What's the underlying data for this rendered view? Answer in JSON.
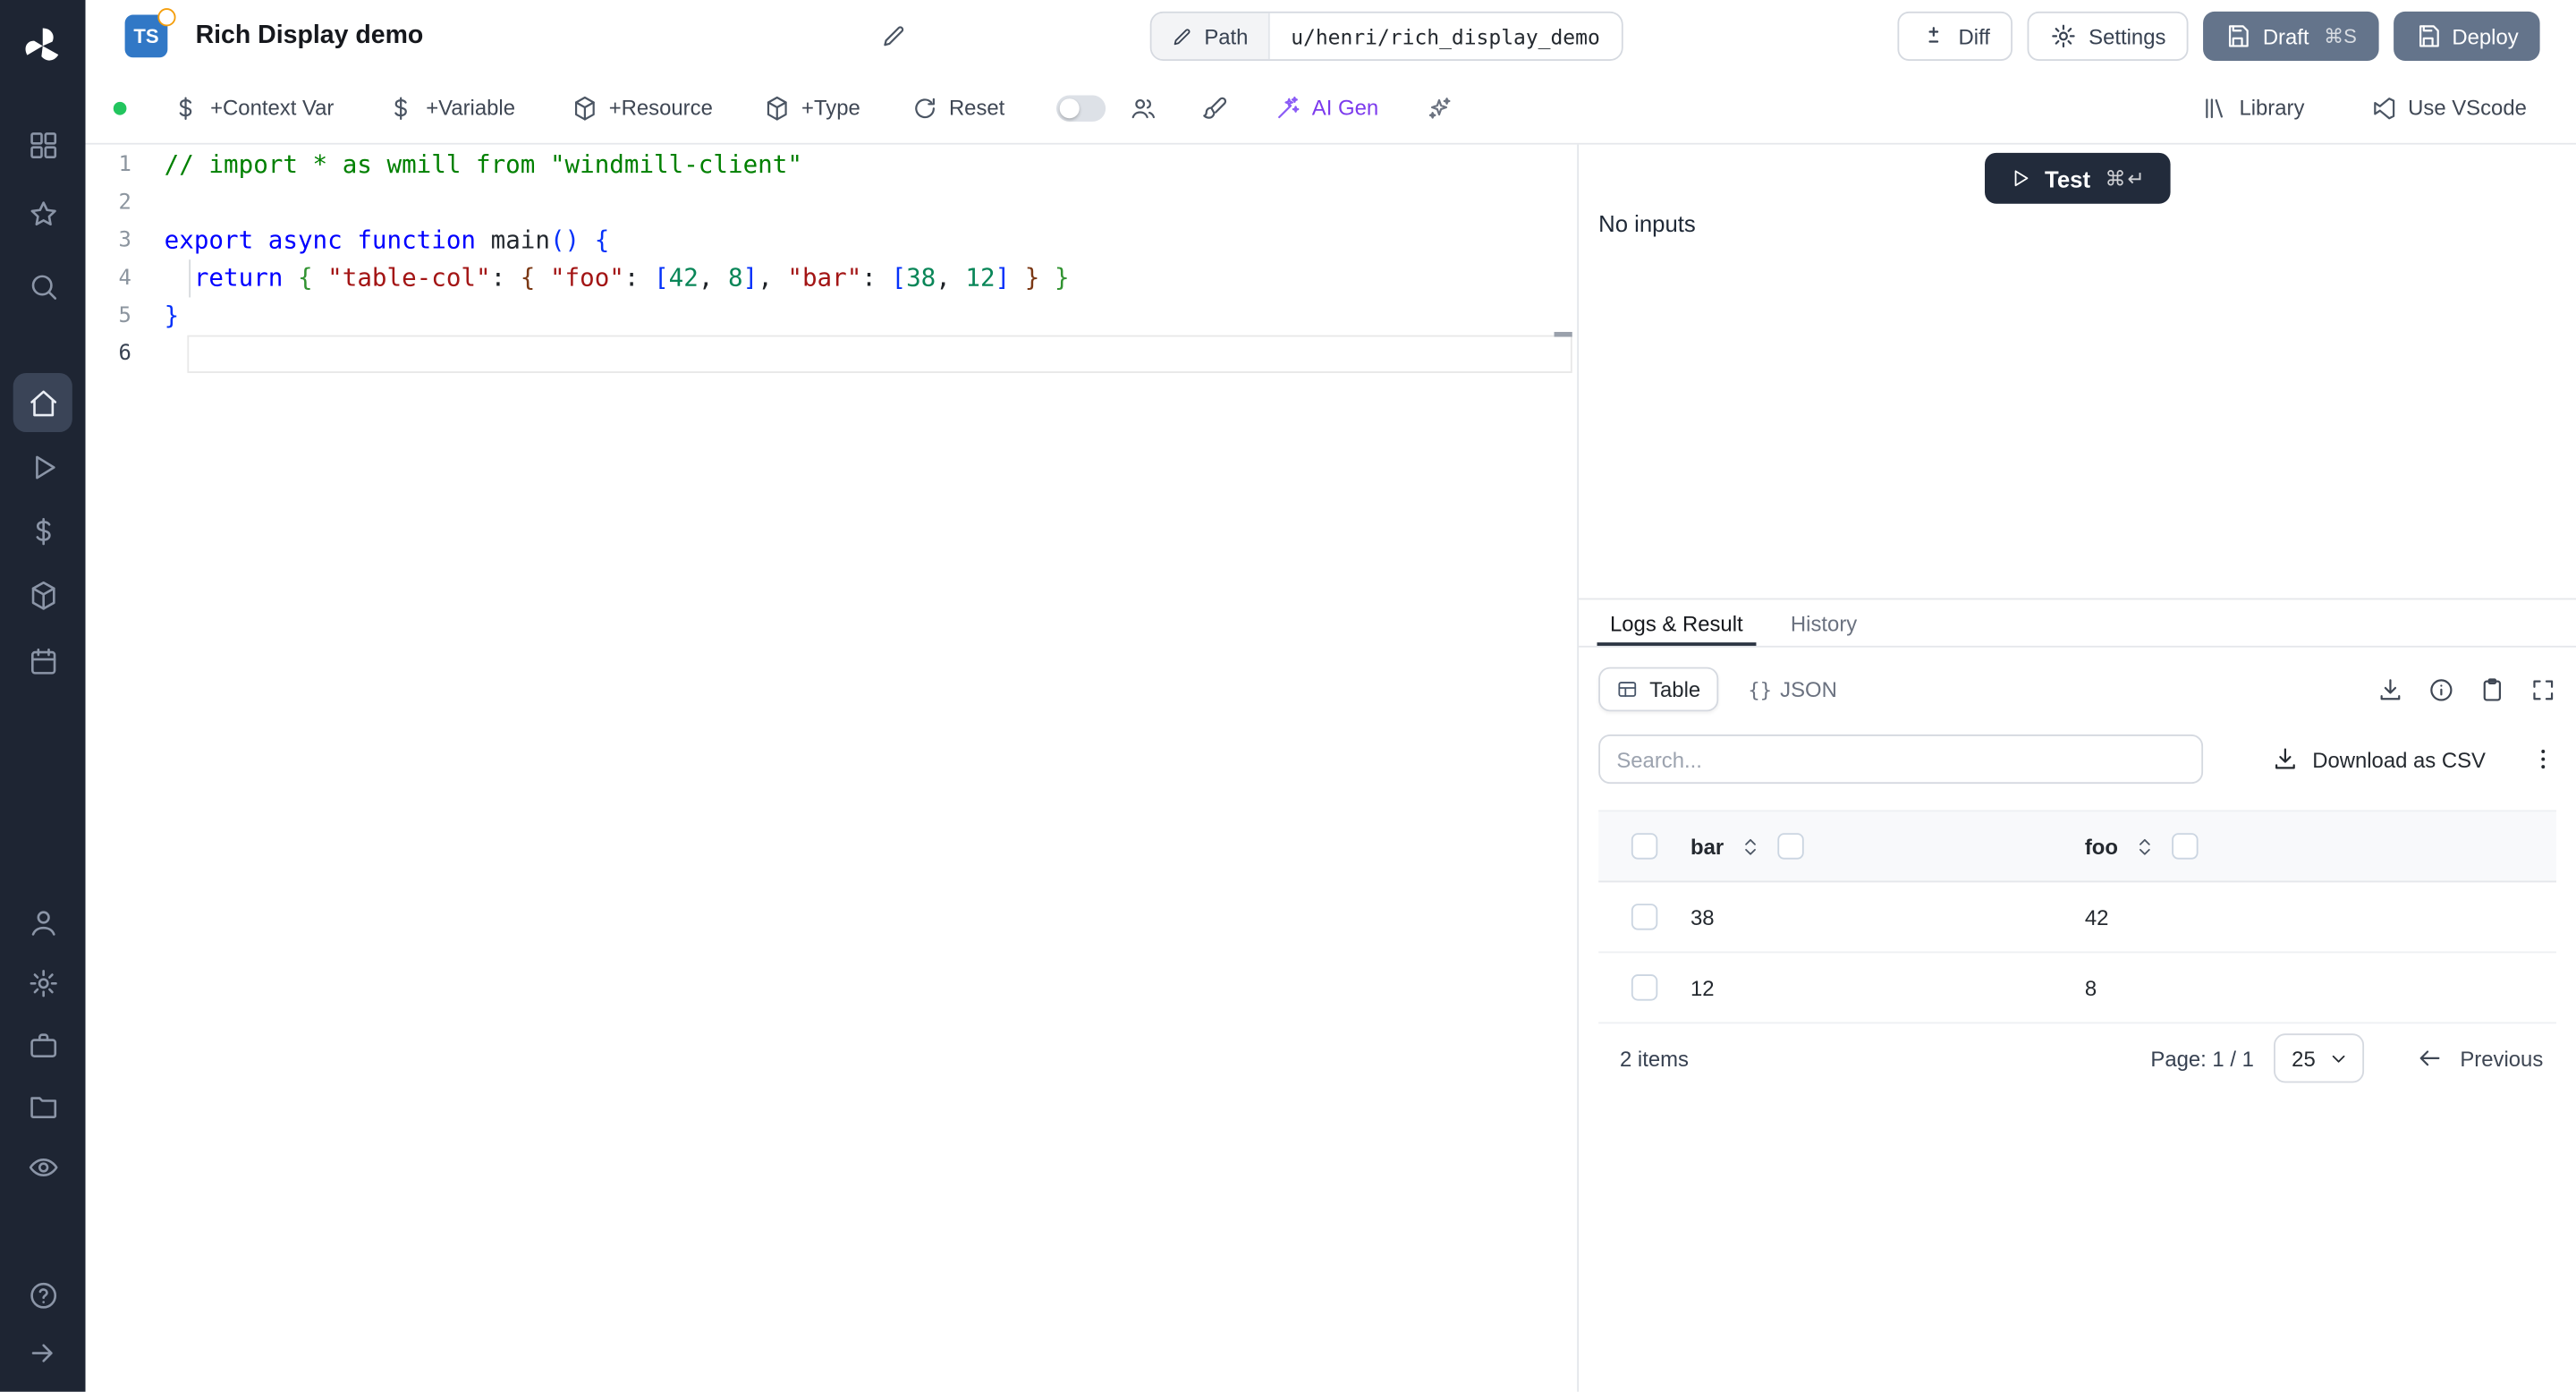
{
  "colors": {
    "sidebar_bg": "#1e2533",
    "button_slate": "#64748b",
    "ai_accent": "#7c3aed",
    "badge_ts_bg": "#3178c6",
    "status_green": "#22c55e",
    "test_button_bg": "#222b3b"
  },
  "sidebar": {
    "items": [
      {
        "icon": "apps-icon"
      },
      {
        "icon": "star-icon"
      },
      {
        "icon": "search-icon"
      },
      {
        "icon": "home-icon",
        "active": true
      },
      {
        "icon": "play-icon"
      },
      {
        "icon": "dollar-icon"
      },
      {
        "icon": "package-icon"
      },
      {
        "icon": "calendar-icon"
      },
      {
        "icon": "user-icon"
      },
      {
        "icon": "gear-icon"
      },
      {
        "icon": "briefcase-icon"
      },
      {
        "icon": "folder-icon"
      },
      {
        "icon": "eye-icon"
      },
      {
        "icon": "help-icon"
      },
      {
        "icon": "collapse-icon"
      }
    ]
  },
  "header": {
    "language_badge": "TS",
    "title": "Rich Display demo",
    "path_label": "Path",
    "path_value": "u/henri/rich_display_demo",
    "diff": "Diff",
    "settings": "Settings",
    "draft": "Draft",
    "draft_shortcut": "⌘S",
    "deploy": "Deploy"
  },
  "toolbar": {
    "context_var": "+Context Var",
    "variable": "+Variable",
    "resource": "+Resource",
    "type": "+Type",
    "reset": "Reset",
    "ai_gen": "AI Gen",
    "library": "Library",
    "vscode": "Use VScode"
  },
  "editor": {
    "lines": [
      {
        "n": "1",
        "tokens": [
          [
            "cmt",
            "// import * as wmill from \"windmill-client\""
          ]
        ]
      },
      {
        "n": "2",
        "tokens": []
      },
      {
        "n": "3",
        "tokens": [
          [
            "kw",
            "export"
          ],
          [
            "pln",
            " "
          ],
          [
            "kw",
            "async"
          ],
          [
            "pln",
            " "
          ],
          [
            "kw",
            "function"
          ],
          [
            "pln",
            " "
          ],
          [
            "fn",
            "main"
          ],
          [
            "b1",
            "()"
          ],
          [
            "pln",
            " "
          ],
          [
            "b1",
            "{"
          ]
        ]
      },
      {
        "n": "4",
        "guide": true,
        "tokens": [
          [
            "pln",
            "  "
          ],
          [
            "kw",
            "return"
          ],
          [
            "pln",
            " "
          ],
          [
            "b2",
            "{"
          ],
          [
            "pln",
            " "
          ],
          [
            "str",
            "\"table-col\""
          ],
          [
            "pln",
            ": "
          ],
          [
            "b3",
            "{"
          ],
          [
            "pln",
            " "
          ],
          [
            "str",
            "\"foo\""
          ],
          [
            "pln",
            ": "
          ],
          [
            "b1",
            "["
          ],
          [
            "num",
            "42"
          ],
          [
            "pln",
            ", "
          ],
          [
            "num",
            "8"
          ],
          [
            "b1",
            "]"
          ],
          [
            "pln",
            ", "
          ],
          [
            "str",
            "\"bar\""
          ],
          [
            "pln",
            ": "
          ],
          [
            "b1",
            "["
          ],
          [
            "num",
            "38"
          ],
          [
            "pln",
            ", "
          ],
          [
            "num",
            "12"
          ],
          [
            "b1",
            "]"
          ],
          [
            "pln",
            " "
          ],
          [
            "b3",
            "}"
          ],
          [
            "pln",
            " "
          ],
          [
            "b2",
            "}"
          ]
        ]
      },
      {
        "n": "5",
        "tokens": [
          [
            "b1",
            "}"
          ]
        ]
      },
      {
        "n": "6",
        "active": true,
        "tokens": []
      }
    ]
  },
  "run": {
    "test": "Test",
    "shortcut": "⌘↵",
    "no_inputs": "No inputs"
  },
  "results": {
    "tab_logs": "Logs & Result",
    "tab_history": "History",
    "view_table": "Table",
    "view_json_braces": "{}",
    "view_json": "JSON",
    "search_placeholder": "Search...",
    "download_csv": "Download as CSV",
    "table": {
      "columns": [
        "bar",
        "foo"
      ],
      "rows": [
        [
          "38",
          "42"
        ],
        [
          "12",
          "8"
        ]
      ]
    },
    "items_count": "2 items",
    "page_info": "Page: 1 / 1",
    "page_size": "25",
    "previous": "Previous"
  }
}
